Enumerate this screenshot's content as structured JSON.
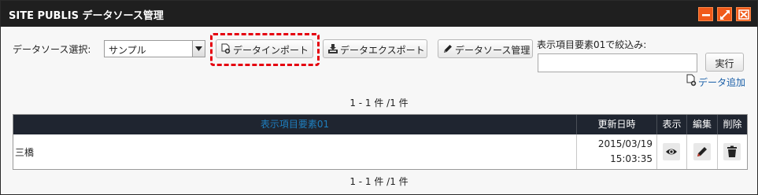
{
  "window": {
    "title": "SITE PUBLIS データソース管理",
    "controls": {
      "minimize_icon": "minimize-icon",
      "maximize_icon": "maximize-icon",
      "close_icon": "close-icon",
      "accent_color": "#f05a1a"
    }
  },
  "toolbar": {
    "datasource_label": "データソース選択:",
    "datasource_selected": "サンプル",
    "import_label": "データインポート",
    "export_label": "データエクスポート",
    "manage_label": "データソース管理",
    "filter_label": "表示項目要素01で絞込み:",
    "filter_value": "",
    "run_label": "実行",
    "add_label": "データ追加",
    "highlight_color": "#e5000f"
  },
  "pager": {
    "top": "1 - 1 件 /1 件",
    "bottom": "1 - 1 件 /1 件"
  },
  "table": {
    "columns": [
      "表示項目要素01",
      "更新日時",
      "表示",
      "編集",
      "削除"
    ],
    "rows": [
      {
        "element01": "三橋",
        "updated_date": "2015/03/19",
        "updated_time": "15:03:35",
        "view_icon": "eye-icon",
        "edit_icon": "pencil-icon",
        "delete_icon": "trash-icon"
      }
    ]
  }
}
